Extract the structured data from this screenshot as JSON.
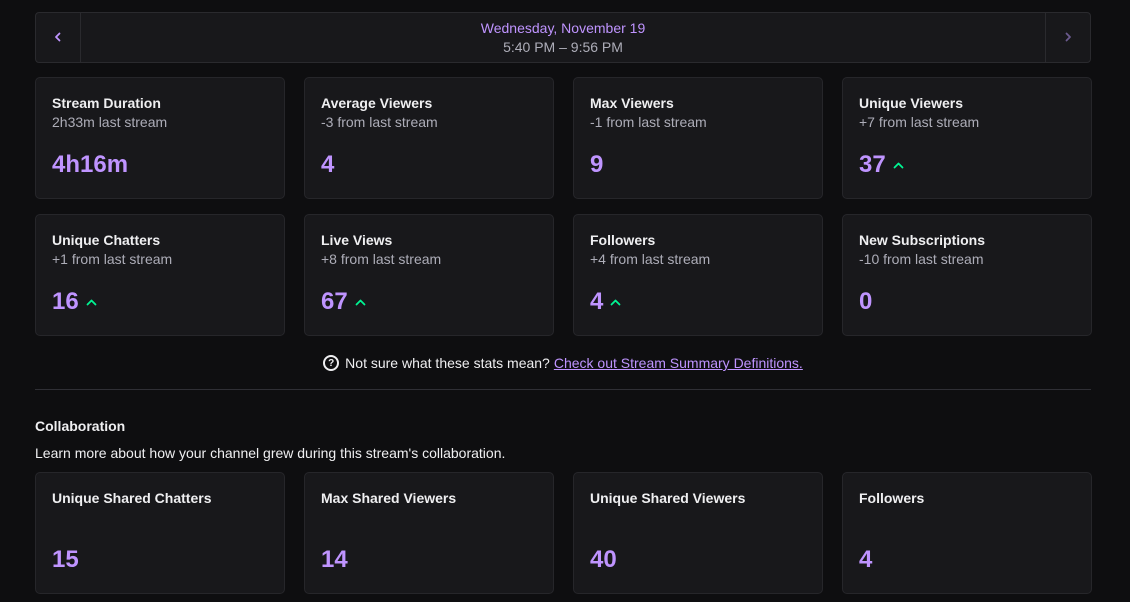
{
  "date_nav": {
    "day": "Wednesday, November 19",
    "time": "5:40 PM – 9:56 PM",
    "prev_icon": "chevron-left-icon",
    "next_icon": "chevron-right-icon"
  },
  "stats": [
    {
      "title": "Stream Duration",
      "sub": "2h33m last stream",
      "value": "4h16m",
      "trend_up": false
    },
    {
      "title": "Average Viewers",
      "sub": "-3 from last stream",
      "value": "4",
      "trend_up": false
    },
    {
      "title": "Max Viewers",
      "sub": "-1 from last stream",
      "value": "9",
      "trend_up": false
    },
    {
      "title": "Unique Viewers",
      "sub": "+7 from last stream",
      "value": "37",
      "trend_up": true
    },
    {
      "title": "Unique Chatters",
      "sub": "+1 from last stream",
      "value": "16",
      "trend_up": true
    },
    {
      "title": "Live Views",
      "sub": "+8 from last stream",
      "value": "67",
      "trend_up": true
    },
    {
      "title": "Followers",
      "sub": "+4 from last stream",
      "value": "4",
      "trend_up": true
    },
    {
      "title": "New Subscriptions",
      "sub": "-10 from last stream",
      "value": "0",
      "trend_up": false
    }
  ],
  "help": {
    "icon": "question-circle-icon",
    "text": "Not sure what these stats mean?",
    "link": "Check out Stream Summary Definitions."
  },
  "collaboration": {
    "title": "Collaboration",
    "description": "Learn more about how your channel grew during this stream's collaboration.",
    "stats": [
      {
        "title": "Unique Shared Chatters",
        "value": "15"
      },
      {
        "title": "Max Shared Viewers",
        "value": "14"
      },
      {
        "title": "Unique Shared Viewers",
        "value": "40"
      },
      {
        "title": "Followers",
        "value": "4"
      }
    ]
  },
  "colors": {
    "accent": "#bf94ff",
    "trend_up": "#00f593",
    "background": "#0e0e10",
    "card": "#18181b"
  }
}
